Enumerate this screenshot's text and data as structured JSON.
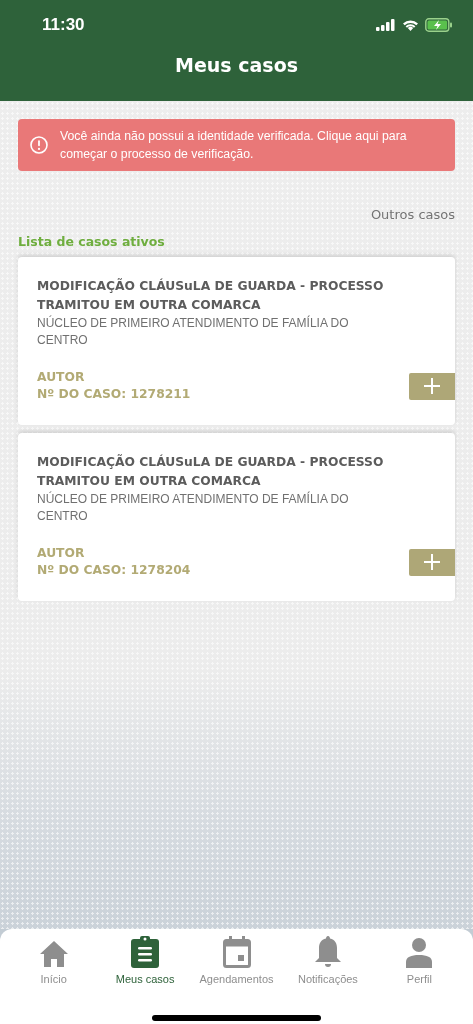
{
  "status_bar": {
    "time": "11:30"
  },
  "header": {
    "title": "Meus casos"
  },
  "alert": {
    "message": "Você ainda não possui a identidade verificada. Clique aqui para começar o processo de verificação."
  },
  "other_cases_link": "Outros casos",
  "section_title": "Lista de casos ativos",
  "cases": [
    {
      "title": "MODIFICAÇÃO CLÁUSuLA DE GUARDA - PROCESSO TRAMITOU EM OUTRA COMARCA",
      "office": "NÚCLEO DE PRIMEIRO ATENDIMENTO DE FAMÍLIA DO CENTRO",
      "role": "AUTOR",
      "case_number": "Nº DO CASO: 1278211"
    },
    {
      "title": "MODIFICAÇÃO CLÁUSuLA DE GUARDA - PROCESSO TRAMITOU EM OUTRA COMARCA",
      "office": "NÚCLEO DE PRIMEIRO ATENDIMENTO DE FAMÍLIA DO CENTRO",
      "role": "AUTOR",
      "case_number": "Nº DO CASO: 1278204"
    }
  ],
  "tabs": [
    {
      "label": "Início",
      "kind": "home",
      "selected": false
    },
    {
      "label": "Meus casos",
      "kind": "clipboard",
      "selected": true
    },
    {
      "label": "Agendamentos",
      "kind": "calendar",
      "selected": false
    },
    {
      "label": "Notificações",
      "kind": "bell",
      "selected": false
    },
    {
      "label": "Perfil",
      "kind": "person",
      "selected": false
    }
  ]
}
